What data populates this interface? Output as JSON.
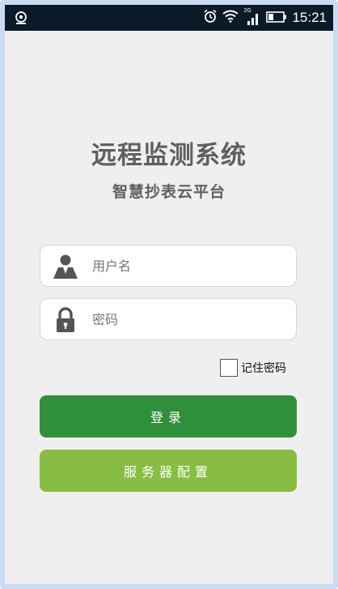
{
  "status_bar": {
    "time": "15:21",
    "network": "2G",
    "icons": [
      "notification-icon",
      "alarm-icon",
      "wifi-icon",
      "signal-icon",
      "battery-icon"
    ]
  },
  "login": {
    "title": "远程监测系统",
    "subtitle": "智慧抄表云平台",
    "username_placeholder": "用户名",
    "password_placeholder": "密码",
    "remember_label": "记住密码",
    "remember_checked": false,
    "login_button": "登录",
    "config_button": "服务器配置"
  },
  "colors": {
    "login_button": "#2f8f3a",
    "config_button": "#86bd42",
    "background": "#efefef",
    "status_bar": "#0b1a28",
    "title_text": "#5f5f5f"
  }
}
